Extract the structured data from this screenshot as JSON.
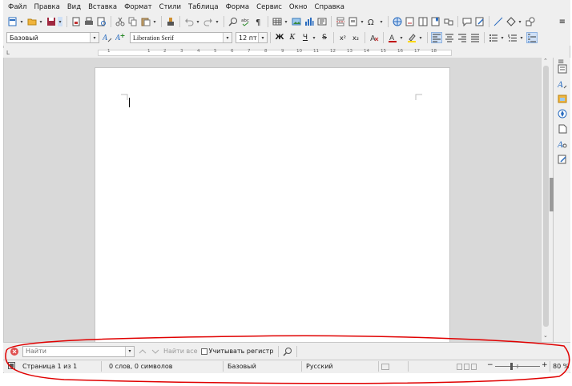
{
  "menu": [
    "Файл",
    "Правка",
    "Вид",
    "Вставка",
    "Формат",
    "Стили",
    "Таблица",
    "Форма",
    "Сервис",
    "Окно",
    "Справка"
  ],
  "formatting": {
    "paragraph_style": "Базовый",
    "font_name": "Liberation Serif",
    "font_size": "12 пт",
    "bold": "Ж",
    "italic": "К",
    "underline": "Ч",
    "strike": "S",
    "superscript": "x²",
    "subscript": "x₂"
  },
  "ruler": {
    "ticks": [
      "1",
      "1",
      "2",
      "3",
      "4",
      "5",
      "6",
      "7",
      "8",
      "9",
      "10",
      "11",
      "12",
      "13",
      "14",
      "15",
      "16",
      "17",
      "18"
    ]
  },
  "find_toolbar": {
    "placeholder": "Найти",
    "find_all": "Найти все",
    "match_case": "Учитывать регистр"
  },
  "status": {
    "page": "Страница 1 из 1",
    "words": "0 слов, 0 символов",
    "page_style": "Базовый",
    "language": "Русский",
    "zoom": "80 %"
  },
  "colors": {
    "accent": "#2a6cbf",
    "font_color": "#c00000",
    "highlight": "#ffd800",
    "annotation": "#e00000"
  }
}
